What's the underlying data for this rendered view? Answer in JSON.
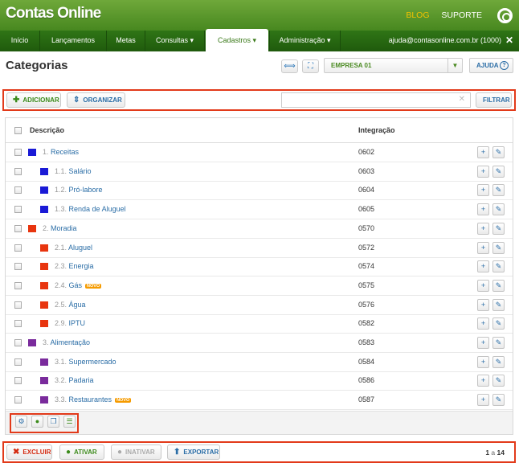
{
  "header": {
    "logo": "Contas Online",
    "blog": "BLOG",
    "suporte": "SUPORTE"
  },
  "nav": {
    "tabs": [
      {
        "label": "Início"
      },
      {
        "label": "Lançamentos"
      },
      {
        "label": "Metas"
      },
      {
        "label": "Consultas ▾"
      },
      {
        "label": "Cadastros ▾"
      },
      {
        "label": "Administração ▾"
      }
    ],
    "active": "Cadastros ▾",
    "user": "ajuda@contasonline.com.br (1000)",
    "close_icon": "close-icon"
  },
  "page": {
    "title": "Categorias",
    "empresa": "EMPRESA 01",
    "ajuda": "AJUDA",
    "help_glyph": "?"
  },
  "toolbar": {
    "add": "ADICIONAR",
    "organize": "ORGANIZAR",
    "search_value": "",
    "filter": "FILTRAR"
  },
  "table": {
    "headers": {
      "description": "Descrição",
      "integration": "Integração"
    },
    "rows": [
      {
        "num": "1.",
        "name": "Receitas",
        "code": "0602",
        "color": "#1a1ad6",
        "level": 0,
        "novo": false
      },
      {
        "num": "1.1.",
        "name": "Salário",
        "code": "0603",
        "color": "#1a1ad6",
        "level": 1,
        "novo": false
      },
      {
        "num": "1.2.",
        "name": "Pró-labore",
        "code": "0604",
        "color": "#1a1ad6",
        "level": 1,
        "novo": false
      },
      {
        "num": "1.3.",
        "name": "Renda de Aluguel",
        "code": "0605",
        "color": "#1a1ad6",
        "level": 1,
        "novo": false
      },
      {
        "num": "2.",
        "name": "Moradia",
        "code": "0570",
        "color": "#e8350f",
        "level": 0,
        "novo": false
      },
      {
        "num": "2.1.",
        "name": "Aluguel",
        "code": "0572",
        "color": "#e8350f",
        "level": 1,
        "novo": false
      },
      {
        "num": "2.3.",
        "name": "Energia",
        "code": "0574",
        "color": "#e8350f",
        "level": 1,
        "novo": false
      },
      {
        "num": "2.4.",
        "name": "Gás",
        "code": "0575",
        "color": "#e8350f",
        "level": 1,
        "novo": true
      },
      {
        "num": "2.5.",
        "name": "Água",
        "code": "0576",
        "color": "#e8350f",
        "level": 1,
        "novo": false
      },
      {
        "num": "2.9.",
        "name": "IPTU",
        "code": "0582",
        "color": "#e8350f",
        "level": 1,
        "novo": false
      },
      {
        "num": "3.",
        "name": "Alimentação",
        "code": "0583",
        "color": "#7a2b9c",
        "level": 0,
        "novo": false
      },
      {
        "num": "3.1.",
        "name": "Supermercado",
        "code": "0584",
        "color": "#7a2b9c",
        "level": 1,
        "novo": false
      },
      {
        "num": "3.2.",
        "name": "Padaria",
        "code": "0586",
        "color": "#7a2b9c",
        "level": 1,
        "novo": false
      },
      {
        "num": "3.3.",
        "name": "Restaurantes",
        "code": "0587",
        "color": "#7a2b9c",
        "level": 1,
        "novo": true
      }
    ],
    "novo_label": "NOVO"
  },
  "panel_footer": {
    "icons": [
      "gear-icon",
      "circle-icon",
      "copy-icon",
      "list-icon"
    ]
  },
  "bottom": {
    "delete": "EXCLUIR",
    "activate": "ATIVAR",
    "inactivate": "INATIVAR",
    "export": "EXPORTAR",
    "pagination": {
      "from": "1",
      "sep": "a",
      "to": "14"
    }
  }
}
